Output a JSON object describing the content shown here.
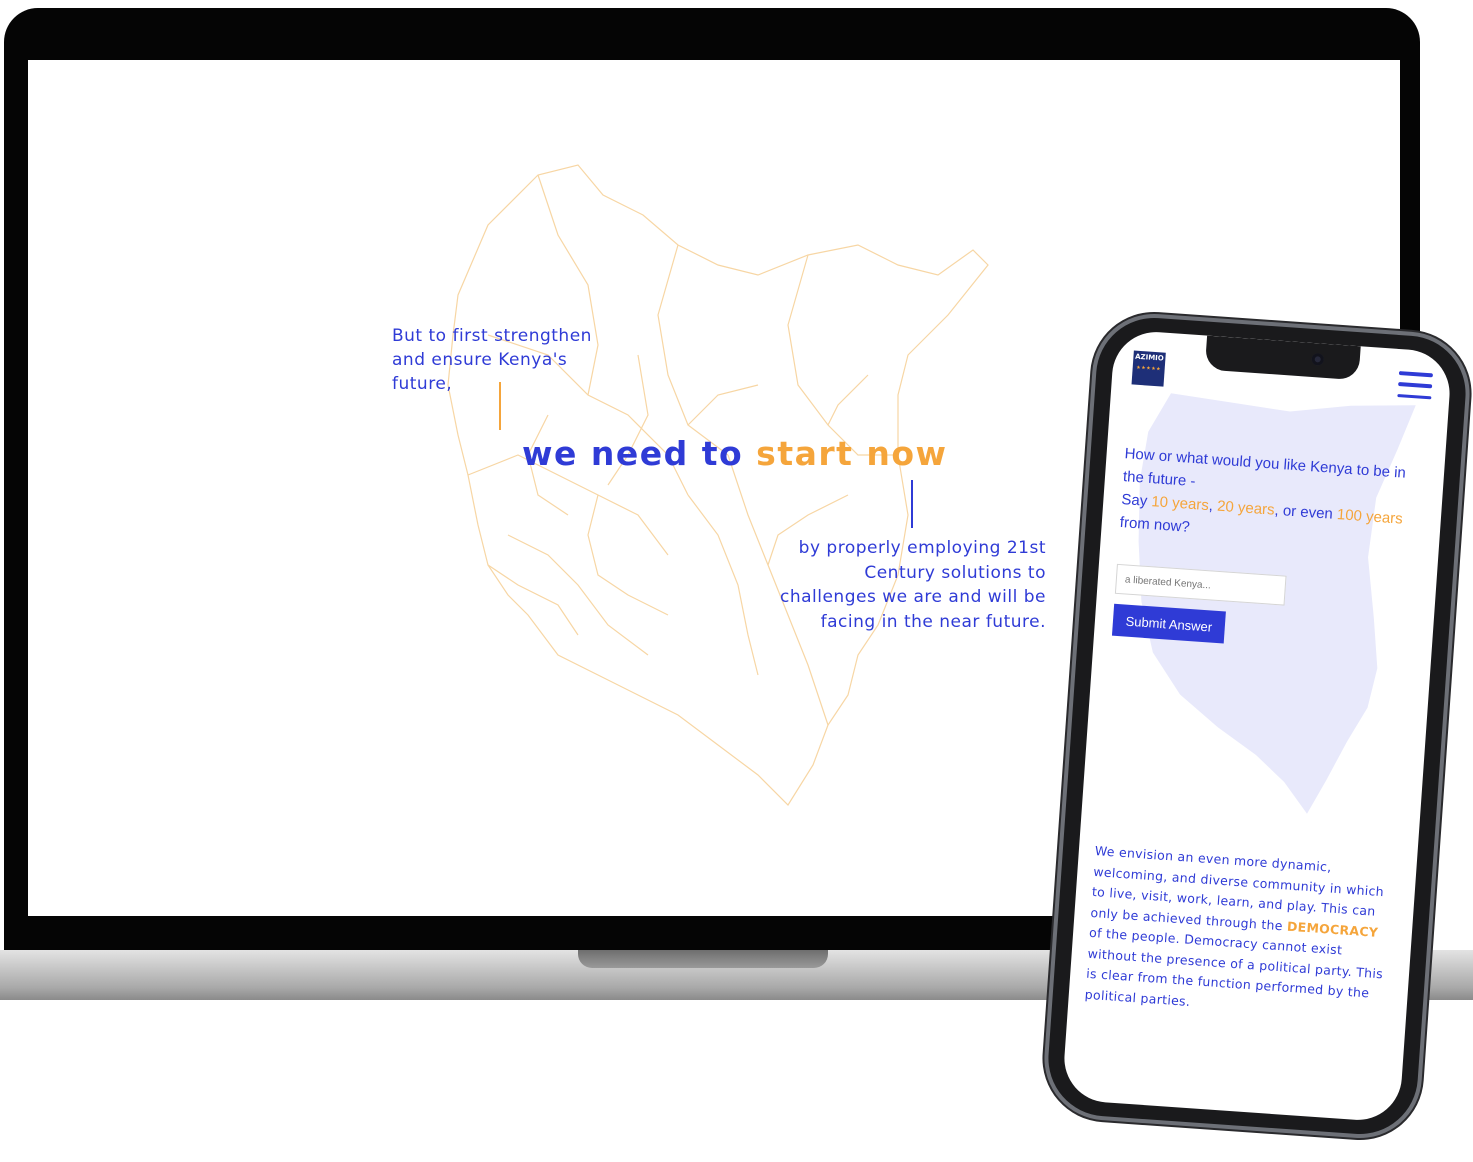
{
  "laptop": {
    "lead_text": "But to first strengthen and ensure Kenya's future,",
    "headline": {
      "part1": "we need to",
      "part2": "start now"
    },
    "follow_text": "by properly employing 21st Century solutions to challenges we are and will be facing in the near future."
  },
  "phone": {
    "logo_text": "AZIMIO",
    "question": {
      "line1": "How or what would you like Kenya to be in the future -",
      "say": "Say",
      "opt1": "10 years",
      "sep1": ",",
      "opt2": "20 years",
      "sep2": ", or even",
      "opt3": "100 years",
      "end": "from now?"
    },
    "answer_placeholder": "a liberated Kenya...",
    "submit_label": "Submit Answer",
    "vision": {
      "part1": "We envision an even more dynamic, welcoming, and diverse community in which to live, visit, work, learn, and play. This can only be achieved through the",
      "highlight": "DEMOCRACY",
      "part2": "of the people. Democracy cannot exist without the presence of a political party. This is clear from the function performed by the political parties."
    }
  },
  "colors": {
    "primary_blue": "#2f3bd6",
    "accent_orange": "#f5a53b",
    "map_fill": "#e8e9fb"
  },
  "icons": {
    "menu": "hamburger-menu-icon",
    "camera": "front-camera-icon"
  }
}
